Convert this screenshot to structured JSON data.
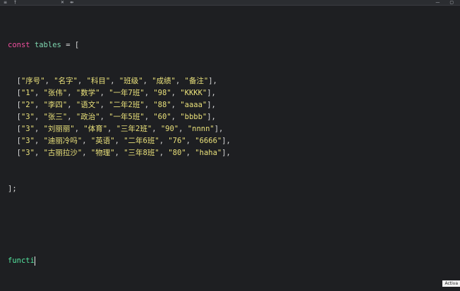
{
  "window": {
    "menu_icon": "≡",
    "tab_title": "†",
    "close_icon": "✕",
    "split_icon": "⇹",
    "minimize_icon": "—",
    "restore_icon": "▢"
  },
  "code": {
    "line1": {
      "kw": "const",
      "name": "tables",
      "rest": " = ["
    },
    "rows": [
      [
        "\"序号\"",
        "\"名字\"",
        "\"科目\"",
        "\"班级\"",
        "\"成绩\"",
        "\"备注\""
      ],
      [
        "\"1\"",
        "\"张伟\"",
        "\"数学\"",
        "\"一年7班\"",
        "\"98\"",
        "\"KKKK\""
      ],
      [
        "\"2\"",
        "\"李四\"",
        "\"语文\"",
        "\"二年2班\"",
        "\"88\"",
        "\"aaaa\""
      ],
      [
        "\"3\"",
        "\"张三\"",
        "\"政治\"",
        "\"一年5班\"",
        "\"60\"",
        "\"bbbb\""
      ],
      [
        "\"3\"",
        "\"刘丽丽\"",
        "\"体育\"",
        "\"三年2班\"",
        "\"90\"",
        "\"nnnn\""
      ],
      [
        "\"3\"",
        "\"迪丽冷吗\"",
        "\"英语\"",
        "\"二年6班\"",
        "\"76\"",
        "\"6666\""
      ],
      [
        "\"3\"",
        "\"古丽拉沙\"",
        "\"物理\"",
        "\"三年8班\"",
        "\"80\"",
        "\"haha\""
      ]
    ],
    "close_line": "];",
    "typing_line": "functi"
  },
  "status": {
    "activate_text": "Activa"
  }
}
